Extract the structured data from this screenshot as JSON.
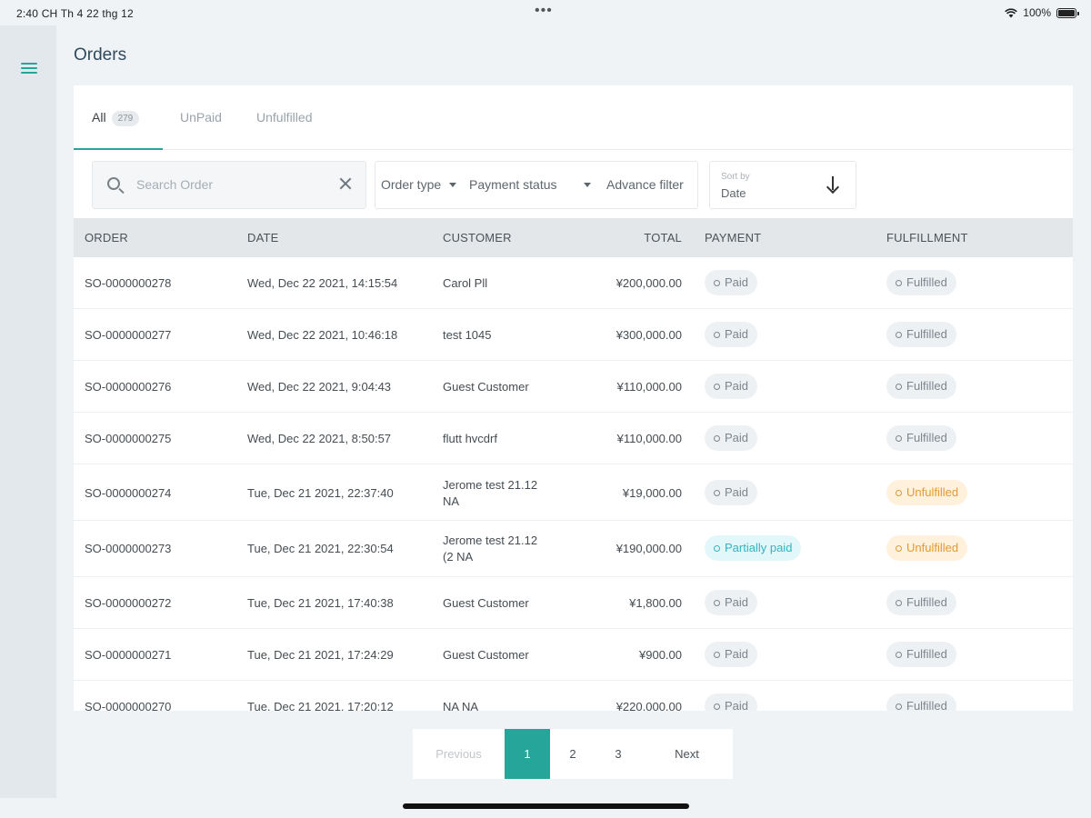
{
  "status_bar": {
    "time": "2:40 CH  Th 4 22 thg 12",
    "dots": "•••",
    "battery": "100%"
  },
  "page_title": "Orders",
  "tabs": [
    {
      "label": "All",
      "count": "279"
    },
    {
      "label": "UnPaid"
    },
    {
      "label": "Unfulfilled"
    }
  ],
  "search": {
    "placeholder": "Search Order",
    "value": ""
  },
  "filters": {
    "order_type": "Order type",
    "payment_status": "Payment status",
    "advance": "Advance filter"
  },
  "sort": {
    "label": "Sort by",
    "value": "Date"
  },
  "table": {
    "headers": {
      "order": "ORDER",
      "date": "DATE",
      "customer": "CUSTOMER",
      "total": "TOTAL",
      "payment": "PAYMENT",
      "fulfillment": "FULFILLMENT"
    },
    "rows": [
      {
        "order": "SO-0000000278",
        "date": "Wed, Dec 22 2021, 14:15:54",
        "customer": "Carol Pll",
        "total": "¥200,000.00",
        "payment": "Paid",
        "fulfillment": "Fulfilled"
      },
      {
        "order": "SO-0000000277",
        "date": "Wed, Dec 22 2021, 10:46:18",
        "customer": "test 1045",
        "total": "¥300,000.00",
        "payment": "Paid",
        "fulfillment": "Fulfilled"
      },
      {
        "order": "SO-0000000276",
        "date": "Wed, Dec 22 2021, 9:04:43",
        "customer": "Guest Customer",
        "total": "¥110,000.00",
        "payment": "Paid",
        "fulfillment": "Fulfilled"
      },
      {
        "order": "SO-0000000275",
        "date": "Wed, Dec 22 2021, 8:50:57",
        "customer": "flutt hvcdrf",
        "total": "¥110,000.00",
        "payment": "Paid",
        "fulfillment": "Fulfilled"
      },
      {
        "order": "SO-0000000274",
        "date": "Tue, Dec 21 2021, 22:37:40",
        "customer_line1": "Jerome test 21.12",
        "customer_line2": "NA",
        "total": "¥19,000.00",
        "payment": "Paid",
        "fulfillment": "Unfulfilled"
      },
      {
        "order": "SO-0000000273",
        "date": "Tue, Dec 21 2021, 22:30:54",
        "customer_line1": "Jerome test 21.12",
        "customer_line2": "(2 NA",
        "total": "¥190,000.00",
        "payment": "Partially paid",
        "fulfillment": "Unfulfilled"
      },
      {
        "order": "SO-0000000272",
        "date": "Tue, Dec 21 2021, 17:40:38",
        "customer": "Guest Customer",
        "total": "¥1,800.00",
        "payment": "Paid",
        "fulfillment": "Fulfilled"
      },
      {
        "order": "SO-0000000271",
        "date": "Tue, Dec 21 2021, 17:24:29",
        "customer": "Guest Customer",
        "total": "¥900.00",
        "payment": "Paid",
        "fulfillment": "Fulfilled"
      },
      {
        "order": "SO-0000000270",
        "date": "Tue, Dec 21 2021, 17:20:12",
        "customer": "NA NA",
        "total": "¥220,000.00",
        "payment": "Paid",
        "fulfillment": "Fulfilled"
      }
    ]
  },
  "pagination": {
    "previous": "Previous",
    "pages": [
      "1",
      "2",
      "3"
    ],
    "next": "Next",
    "current": "1"
  },
  "colors": {
    "accent": "#26a69a",
    "partial_paid": "#35b3c2",
    "unfulfilled": "#e39a35"
  }
}
